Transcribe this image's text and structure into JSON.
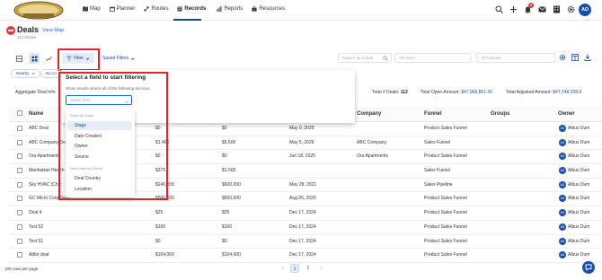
{
  "nav": {
    "logo_text": "BRIDGWATER",
    "items": [
      {
        "label": "Map",
        "icon": "map-icon"
      },
      {
        "label": "Planner",
        "icon": "calendar-icon"
      },
      {
        "label": "Routes",
        "icon": "route-icon"
      },
      {
        "label": "Records",
        "icon": "records-icon",
        "active": true
      },
      {
        "label": "Reports",
        "icon": "chart-icon"
      },
      {
        "label": "Resources",
        "icon": "briefcase-icon"
      }
    ],
    "notification_count": "5",
    "avatar": "AD"
  },
  "header": {
    "title": "Deals",
    "view_map": "View Map",
    "shows": "112 shows"
  },
  "toolbar": {
    "filter_label": "Filter",
    "saved_filters_label": "Saved Filters",
    "search_placeholder": "Search for a deal",
    "users_placeholder": "All Users",
    "funnels_placeholder": "All Funnels",
    "chip_nearby": "Nearby",
    "chip_no": "No co"
  },
  "summary": {
    "aggregate_label": "Aggregate Deal Info",
    "total_deals_label": "Total # Deals:",
    "total_deals_value": "112",
    "open_amount_label": "Total Open Amount:",
    "open_amount_value": "$47,966,801.00",
    "adjusted_label": "Total Adjusted Amount:",
    "adjusted_value": "$47,148,028.5"
  },
  "table": {
    "headers": {
      "name": "Name",
      "company": "Company",
      "funnel": "Funnel",
      "groups": "Groups",
      "owner": "Owner"
    },
    "rows": [
      {
        "name": "ABC Deal",
        "amount": "$0",
        "adjusted": "$0",
        "date": "May 9, 2025",
        "company": "",
        "funnel": "Product Sales Funnel",
        "owner": "Albus Dum"
      },
      {
        "name": "ABC Company Deal",
        "amount": "$1,400",
        "adjusted": "$5,600",
        "date": "May 5, 2026",
        "company": "ABC Company",
        "funnel": "Sales Funnel",
        "owner": "Albus Dum"
      },
      {
        "name": "Ora Apartments",
        "amount": "$0",
        "adjusted": "$0",
        "date": "Jun 18, 2025",
        "company": "Ora Apartments",
        "funnel": "Product Sales Funnel",
        "owner": "Albus Dum"
      },
      {
        "name": "Manhattan Health Deal",
        "amount": "$375",
        "adjusted": "$1,500",
        "date": "",
        "company": "",
        "funnel": "Sales Funnel",
        "owner": "Albus Dum"
      },
      {
        "name": "Sky HVAC (Chic",
        "amount": "$240,000",
        "adjusted": "$600,000",
        "date": "May 28, 2021",
        "company": "",
        "funnel": "Sales Pipeline",
        "owner": "Albus Dum"
      },
      {
        "name": "GC Micro Corp Deal",
        "amount": "$500,000",
        "adjusted": "$500,000",
        "date": "Aug 26, 2020",
        "company": "",
        "funnel": "Product Sales Funnel",
        "owner": "Albus Dum"
      },
      {
        "name": "Deal 4",
        "amount": "$25",
        "adjusted": "$25",
        "date": "Dec 17, 2024",
        "company": "",
        "funnel": "Product Sales Funnel",
        "owner": "Albus Dum"
      },
      {
        "name": "Test 52",
        "amount": "$100",
        "adjusted": "$100",
        "date": "Dec 17, 2024",
        "company": "",
        "funnel": "Product Sales Funnel",
        "owner": "Albus Dum"
      },
      {
        "name": "Test 51",
        "amount": "$0",
        "adjusted": "$0",
        "date": "Dec 17, 2024",
        "company": "",
        "funnel": "Product Sales Funnel",
        "owner": "Albus Dum"
      },
      {
        "name": "Adler deal",
        "amount": "$104,000",
        "adjusted": "$104,000",
        "date": "Dec 17, 2024",
        "company": "",
        "funnel": "Product Sales Funnel",
        "owner": "Albus Dum"
      }
    ],
    "owner_initials": "AD"
  },
  "filter_popup": {
    "title": "Select a field to start filtering",
    "subtitle": "Show results where all of the following are true...",
    "input_placeholder": "Select field",
    "groups": [
      {
        "label": "Recently Used",
        "items": [
          "Stage",
          "Date Created",
          "Owner",
          "Source"
        ]
      },
      {
        "label": "Deal Address Fields",
        "items": [
          "Deal Country",
          "Location"
        ]
      }
    ],
    "highlighted_item": "Stage"
  },
  "footer": {
    "rows_per_page": "100 rows per page",
    "pages": [
      "1",
      "2"
    ],
    "current_page": "1"
  },
  "colors": {
    "accent": "#1a4ea8",
    "highlight_box": "#e1232a",
    "record_icon": "#e53935"
  }
}
